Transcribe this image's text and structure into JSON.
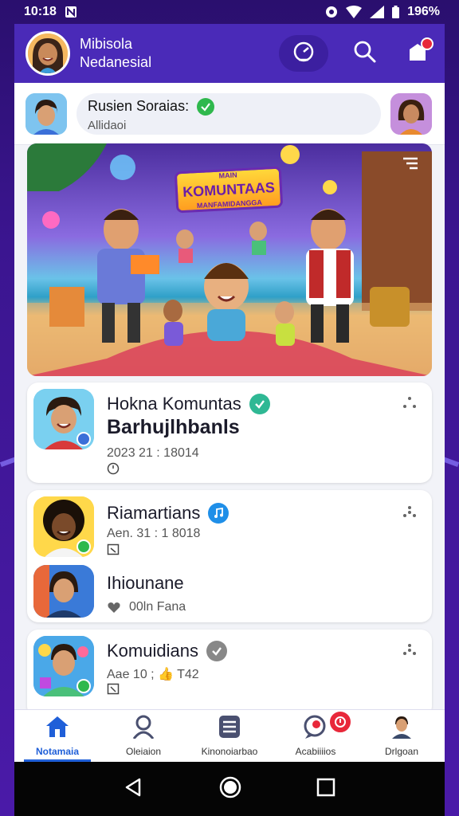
{
  "status_bar": {
    "time": "10:18",
    "battery": "196%"
  },
  "header": {
    "title_line1": "Mibisola",
    "title_line2": "Nedanesial",
    "actions": [
      "radar-icon",
      "search-icon",
      "notification-icon"
    ]
  },
  "story": {
    "name": "Rusien Soraias:",
    "subtitle": "Allidaoi"
  },
  "banner": {
    "title_top": "MAIN",
    "title_main": "KOMUNTAAS",
    "title_sub": "MANFAMIDANGGA"
  },
  "cards": [
    {
      "title": "Hokna Komuntas",
      "big_text": "Barhujlhbanls",
      "meta": "2023 21 : 18014",
      "status_color": "#2fb894"
    },
    {
      "title": "Riamartians",
      "meta": "Aen. 31 : 1 8018",
      "status_color": "#1f8fe8",
      "sub_title": "Ihiounane",
      "sub_meta": "00ln Fana"
    },
    {
      "title": "Komuidians",
      "meta": "Aae 10 ; 👍 T42",
      "status_color": "#888888"
    }
  ],
  "bottom_nav": [
    {
      "label": "Notamaia",
      "icon": "home-icon",
      "active": true
    },
    {
      "label": "Oleiaion",
      "icon": "profile-icon",
      "active": false
    },
    {
      "label": "Kinonoiarbao",
      "icon": "list-icon",
      "active": false
    },
    {
      "label": "Acabiiiios",
      "icon": "chat-icon",
      "active": false
    },
    {
      "label": "Drlgoan",
      "icon": "user-icon",
      "active": false
    }
  ],
  "colors": {
    "accent": "#4a2ab8",
    "active_nav": "#1f5fd8",
    "notification": "#e8283a"
  }
}
